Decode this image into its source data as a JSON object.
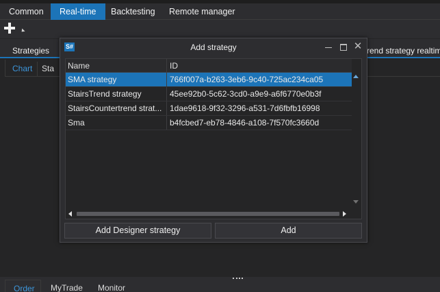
{
  "main_tabs": [
    {
      "label": "Common",
      "active": false
    },
    {
      "label": "Real-time",
      "active": true
    },
    {
      "label": "Backtesting",
      "active": false
    },
    {
      "label": "Remote manager",
      "active": false
    }
  ],
  "sub_tabs": {
    "strategies": "Strategies",
    "right_cut": "rend strategy realtim"
  },
  "chart_tabs": {
    "chart": "Chart",
    "stat": "Sta"
  },
  "bottom_tabs": [
    "Order",
    "MyTrade",
    "Monitor"
  ],
  "dialog": {
    "logo": "S#",
    "title": "Add strategy",
    "close_glyph": "✕",
    "columns": [
      "Name",
      "ID"
    ],
    "rows": [
      {
        "name": "SMA strategy",
        "id": "766f007a-b263-3eb6-9c40-725ac234ca05",
        "selected": true
      },
      {
        "name": "StairsTrend strategy",
        "id": "45ee92b0-5c62-3cd0-a9e9-a6f6770e0b3f",
        "selected": false
      },
      {
        "name": "StairsCountertrend strat...",
        "id": "1dae9618-9f32-3296-a531-7d6fbfb16998",
        "selected": false
      },
      {
        "name": "Sma",
        "id": "b4fcbed7-eb78-4846-a108-7f570fc3660d",
        "selected": false
      }
    ],
    "buttons": {
      "designer": "Add Designer strategy",
      "add": "Add"
    }
  },
  "colors": {
    "accent": "#1c74b8",
    "background": "#252526",
    "panel": "#2d2d30",
    "link_text": "#3d96db"
  }
}
